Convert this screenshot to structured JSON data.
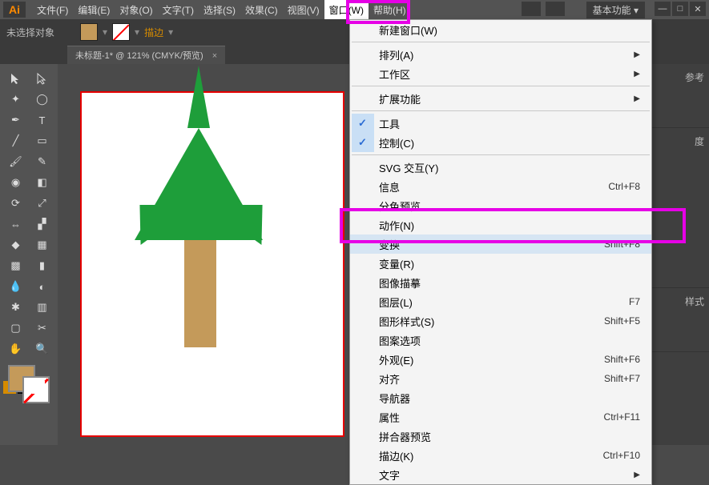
{
  "menubar": {
    "items": [
      "文件(F)",
      "编辑(E)",
      "对象(O)",
      "文字(T)",
      "选择(S)",
      "效果(C)",
      "视图(V)",
      "窗口(W)",
      "帮助(H)"
    ],
    "active_index": 7
  },
  "workspace_switcher": "基本功能",
  "selection_status": "未选择对象",
  "stroke_label": "描边",
  "document_tab": {
    "title": "未标题-1* @ 121% (CMYK/预览)"
  },
  "right_panel_tabs": [
    "参考",
    "度",
    "样式"
  ],
  "window_menu": {
    "items": [
      {
        "label": "新建窗口(W)"
      },
      {
        "sep": true
      },
      {
        "label": "排列(A)",
        "submenu": true
      },
      {
        "label": "工作区",
        "submenu": true
      },
      {
        "sep": true
      },
      {
        "label": "扩展功能",
        "submenu": true
      },
      {
        "sep": true
      },
      {
        "label": "工具",
        "checked": true
      },
      {
        "label": "控制(C)",
        "checked": true
      },
      {
        "sep": true
      },
      {
        "label": "SVG 交互(Y)"
      },
      {
        "label": "信息",
        "shortcut": "Ctrl+F8"
      },
      {
        "label": "分色预览"
      },
      {
        "label": "动作(N)"
      },
      {
        "label": "变换",
        "shortcut": "Shift+F8",
        "hover": true
      },
      {
        "label": "变量(R)"
      },
      {
        "label": "图像描摹"
      },
      {
        "label": "图层(L)",
        "shortcut": "F7"
      },
      {
        "label": "图形样式(S)",
        "shortcut": "Shift+F5"
      },
      {
        "label": "图案选项"
      },
      {
        "label": "外观(E)",
        "shortcut": "Shift+F6"
      },
      {
        "label": "对齐",
        "shortcut": "Shift+F7"
      },
      {
        "label": "导航器"
      },
      {
        "label": "属性",
        "shortcut": "Ctrl+F11"
      },
      {
        "label": "拼合器预览"
      },
      {
        "label": "描边(K)",
        "shortcut": "Ctrl+F10"
      },
      {
        "label": "文字",
        "submenu": true
      }
    ]
  },
  "colors": {
    "fill": "#c49a5a",
    "tree_green": "#1e9e3a",
    "artboard_border": "#e60000",
    "highlight": "#e600e6"
  }
}
